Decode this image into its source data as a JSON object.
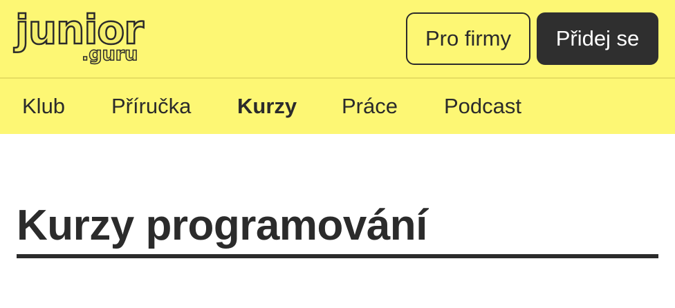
{
  "logo": {
    "word": "junior",
    "sub": ".guru"
  },
  "header": {
    "business_label": "Pro firmy",
    "join_label": "Přidej se"
  },
  "nav": {
    "items": [
      {
        "label": "Klub"
      },
      {
        "label": "Příručka"
      },
      {
        "label": "Kurzy",
        "active": true
      },
      {
        "label": "Práce"
      },
      {
        "label": "Podcast"
      }
    ]
  },
  "main": {
    "title": "Kurzy programování"
  },
  "colors": {
    "brand_yellow": "#fdf774",
    "dark": "#2b2b2b",
    "button_dark": "#2f2f2f"
  }
}
